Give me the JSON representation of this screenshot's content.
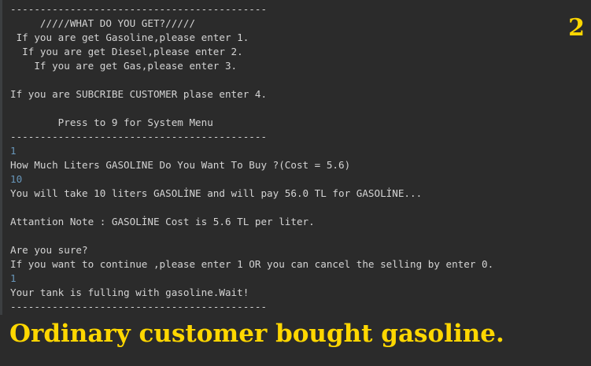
{
  "slide_number": "2",
  "caption": "Ordinary customer bought gasoline.",
  "console": {
    "lines": [
      {
        "text": "-------------------------------------------",
        "type": "output"
      },
      {
        "text": "     /////WHAT DO YOU GET?/////",
        "type": "output"
      },
      {
        "text": " If you are get Gasoline,please enter 1.",
        "type": "output"
      },
      {
        "text": "  If you are get Diesel,please enter 2.",
        "type": "output"
      },
      {
        "text": "    If you are get Gas,please enter 3.",
        "type": "output"
      },
      {
        "text": "",
        "type": "output"
      },
      {
        "text": "If you are SUBCRIBE CUSTOMER plase enter 4.",
        "type": "output"
      },
      {
        "text": "",
        "type": "output"
      },
      {
        "text": "        Press to 9 for System Menu",
        "type": "output"
      },
      {
        "text": "-------------------------------------------",
        "type": "output"
      },
      {
        "text": "1",
        "type": "input"
      },
      {
        "text": "How Much Liters GASOLINE Do You Want To Buy ?(Cost = 5.6)",
        "type": "output"
      },
      {
        "text": "10",
        "type": "input"
      },
      {
        "text": "You will take 10 liters GASOLİNE and will pay 56.0 TL for GASOLİNE...",
        "type": "output"
      },
      {
        "text": "",
        "type": "output"
      },
      {
        "text": "Attantion Note : GASOLİNE Cost is 5.6 TL per liter.",
        "type": "output"
      },
      {
        "text": "",
        "type": "output"
      },
      {
        "text": "Are you sure?",
        "type": "output"
      },
      {
        "text": "If you want to continue ,please enter 1 OR you can cancel the selling by enter 0.",
        "type": "output"
      },
      {
        "text": "1",
        "type": "input"
      },
      {
        "text": "Your tank is fulling with gasoline.Wait!",
        "type": "output"
      },
      {
        "text": "-------------------------------------------",
        "type": "output"
      }
    ]
  }
}
